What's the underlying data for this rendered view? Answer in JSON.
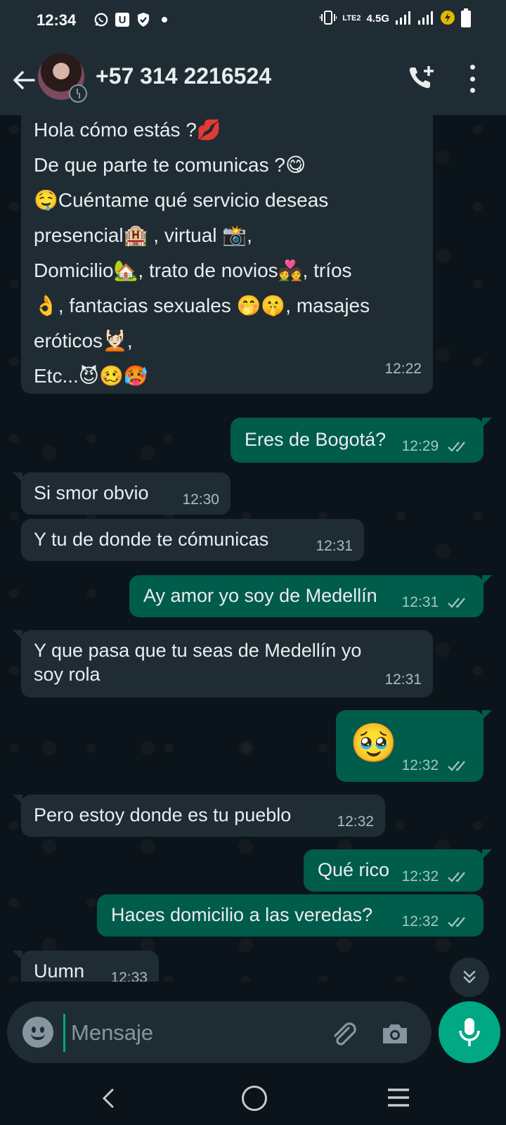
{
  "status_bar": {
    "time": "12:34",
    "network_label": "4.5G",
    "lte_label": "LTE2"
  },
  "header": {
    "contact_name": "+57 314 2216524"
  },
  "messages": [
    {
      "direction": "in",
      "lines": [
        "Hola cómo estás ?💋",
        "De que parte te comunicas ?😋",
        "🤤Cuéntame qué servicio deseas",
        "presencial🏨 , virtual 📸,",
        "Domicilio🏡, trato de novios💑,  tríos",
        "👌, fantacias sexuales 🤭🤫, masajes",
        "eróticos💆🏻,",
        "Etc...😈🥴🥵"
      ],
      "time": "12:22"
    },
    {
      "direction": "out",
      "text": "Eres de Bogotá?",
      "time": "12:29"
    },
    {
      "direction": "in",
      "text": "Si smor obvio",
      "time": "12:30"
    },
    {
      "direction": "in",
      "text": "Y tu de donde te cómunicas",
      "time": "12:31"
    },
    {
      "direction": "out",
      "text": "Ay amor yo soy de Medellín",
      "time": "12:31"
    },
    {
      "direction": "in",
      "text": "Y que pasa que tu seas de Medellín yo soy rola",
      "time": "12:31"
    },
    {
      "direction": "out",
      "text": "🥹",
      "time": "12:32"
    },
    {
      "direction": "in",
      "text": "Pero estoy donde es tu pueblo",
      "time": "12:32"
    },
    {
      "direction": "out",
      "text": "Qué rico",
      "time": "12:32"
    },
    {
      "direction": "out",
      "text": "Haces domicilio a las veredas?",
      "time": "12:32"
    },
    {
      "direction": "in",
      "text": "Uumn",
      "time": "12:33"
    }
  ],
  "composer": {
    "placeholder": "Mensaje"
  },
  "colors": {
    "incoming_bubble": "#1f2c34",
    "outgoing_bubble": "#005c4b",
    "accent": "#00a884",
    "background": "#0b141a"
  }
}
